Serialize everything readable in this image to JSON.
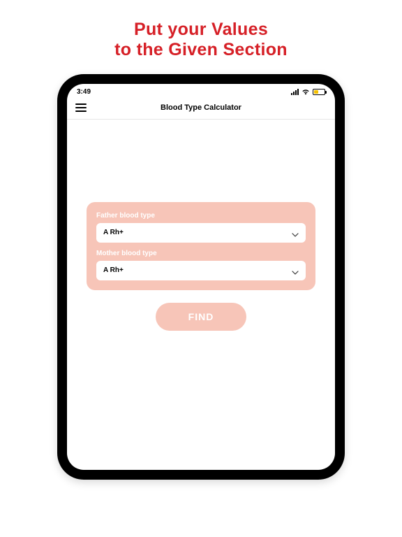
{
  "promo": {
    "line1": "Put your Values",
    "line2": "to the Given Section"
  },
  "status": {
    "time": "3:49"
  },
  "header": {
    "title": "Blood Type Calculator"
  },
  "form": {
    "father_label": "Father blood type",
    "father_value": "A Rh+",
    "mother_label": "Mother blood type",
    "mother_value": "A Rh+",
    "find_label": "FIND"
  }
}
